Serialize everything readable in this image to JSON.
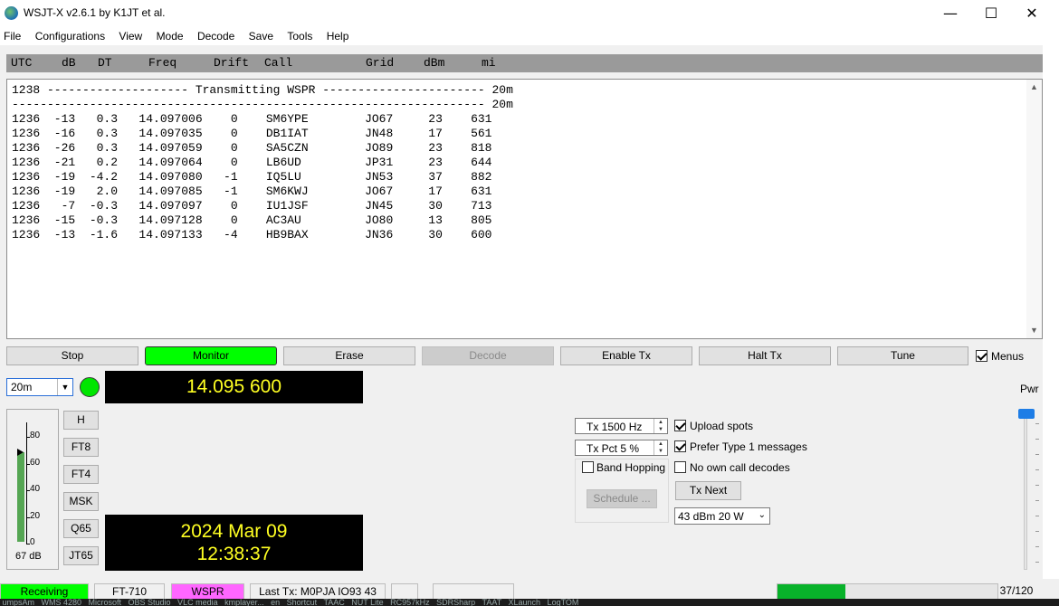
{
  "window": {
    "title": "WSJT-X   v2.6.1   by K1JT et al.",
    "minimize": "—",
    "maximize": "☐",
    "close": "✕"
  },
  "menu": [
    "File",
    "Configurations",
    "View",
    "Mode",
    "Decode",
    "Save",
    "Tools",
    "Help"
  ],
  "decode_header": {
    "utc": "UTC",
    "db": "dB",
    "dt": "DT",
    "freq": "Freq",
    "drift": "Drift",
    "call": "Call",
    "grid": "Grid",
    "dbm": "dBm",
    "mi": "mi"
  },
  "decode_lines": [
    "1238 -------------------- Transmitting WSPR ----------------------- 20m",
    "------------------------------------------------------------------- 20m",
    "1236  -13   0.3   14.097006    0    SM6YPE        JO67     23    631",
    "1236  -16   0.3   14.097035    0    DB1IAT        JN48     17    561",
    "1236  -26   0.3   14.097059    0    SA5CZN        JO89     23    818",
    "1236  -21   0.2   14.097064    0    LB6UD         JP31     23    644",
    "1236  -19  -4.2   14.097080   -1    IQ5LU         JN53     37    882",
    "1236  -19   2.0   14.097085   -1    SM6KWJ        JO67     17    631",
    "1236   -7  -0.3   14.097097    0    IU1JSF        JN45     30    713",
    "1236  -15  -0.3   14.097128    0    AC3AU         JO80     13    805",
    "1236  -13  -1.6   14.097133   -4    HB9BAX        JN36     30    600"
  ],
  "buttons": {
    "stop": "Stop",
    "monitor": "Monitor",
    "erase": "Erase",
    "decode": "Decode",
    "enable_tx": "Enable Tx",
    "halt_tx": "Halt Tx",
    "tune": "Tune",
    "menus": "Menus"
  },
  "band": "20m",
  "frequency": "14.095 600",
  "meter": {
    "ticks": [
      "80",
      "60",
      "40",
      "20",
      "0"
    ],
    "level_db": "67 dB",
    "level_fraction": 0.67
  },
  "modes": [
    "H",
    "FT8",
    "FT4",
    "MSK",
    "Q65",
    "JT65"
  ],
  "clock": {
    "date": "2024 Mar 09",
    "time": "12:38:37"
  },
  "controls": {
    "tx_freq": "Tx  1500  Hz",
    "tx_pct": "Tx Pct 5  %",
    "band_hopping": "Band Hopping",
    "schedule": "Schedule ...",
    "upload_spots": "Upload spots",
    "prefer_type1": "Prefer Type 1 messages",
    "no_own_call": "No own call decodes",
    "tx_next": "Tx Next",
    "power": "43 dBm  20 W",
    "pwr_label": "Pwr"
  },
  "status": {
    "receiving": "Receiving",
    "rig": "FT-710",
    "mode": "WSPR",
    "last_tx": "Last Tx: M0PJA IO93 43",
    "progress": "37/120",
    "progress_fraction": 0.308,
    "colors": {
      "receiving": "#00ff00",
      "mode": "#ff66ff",
      "progress": "#08b22a"
    }
  },
  "taskbar_text": " umpsAm   WMS 4280   Microsoft   OBS Studio   VLC media   kmplayer...   en   Shortcut   TAAC   NUT Lite   RC957kHz   SDRSharp   TAAT   XLaunch   LogTOM"
}
